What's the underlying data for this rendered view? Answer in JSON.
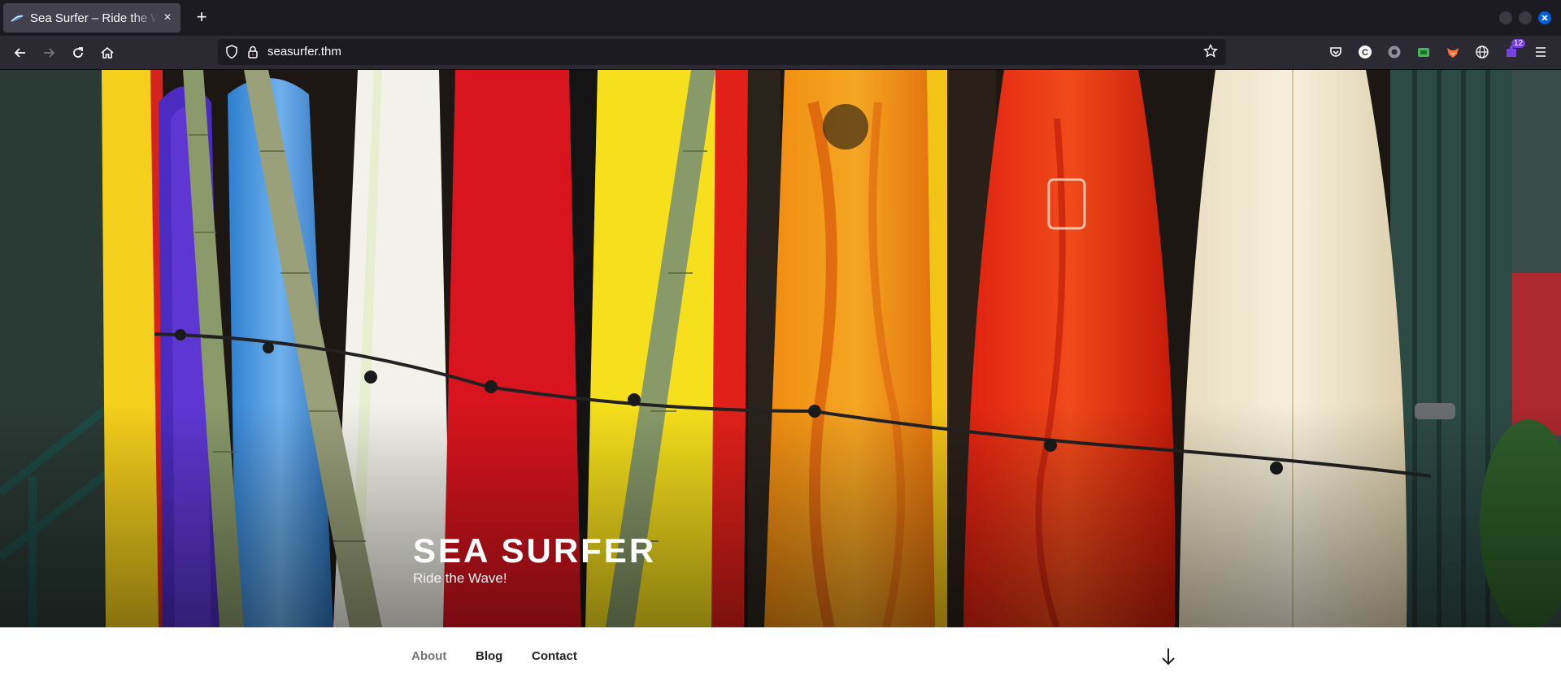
{
  "browser": {
    "tab": {
      "title": "Sea Surfer – Ride the Wave!",
      "close_glyph": "×"
    },
    "new_tab_glyph": "+",
    "url": "seasurfer.thm",
    "extensions_badge": "12"
  },
  "site": {
    "title": "SEA SURFER",
    "description": "Ride the Wave!"
  },
  "nav": {
    "items": [
      {
        "label": "About",
        "current": true
      },
      {
        "label": "Blog",
        "current": false
      },
      {
        "label": "Contact",
        "current": false
      }
    ]
  },
  "icons": {
    "back": "back-arrow-icon",
    "forward": "forward-arrow-icon",
    "reload": "reload-icon",
    "home": "home-icon",
    "shield": "shield-icon",
    "lock": "lock-icon",
    "bookmark": "star-icon",
    "scroll": "arrow-down-icon"
  },
  "colors": {
    "tabstrip": "#1c1b22",
    "toolbar": "#2b2a33",
    "close_window": "#0060df"
  }
}
